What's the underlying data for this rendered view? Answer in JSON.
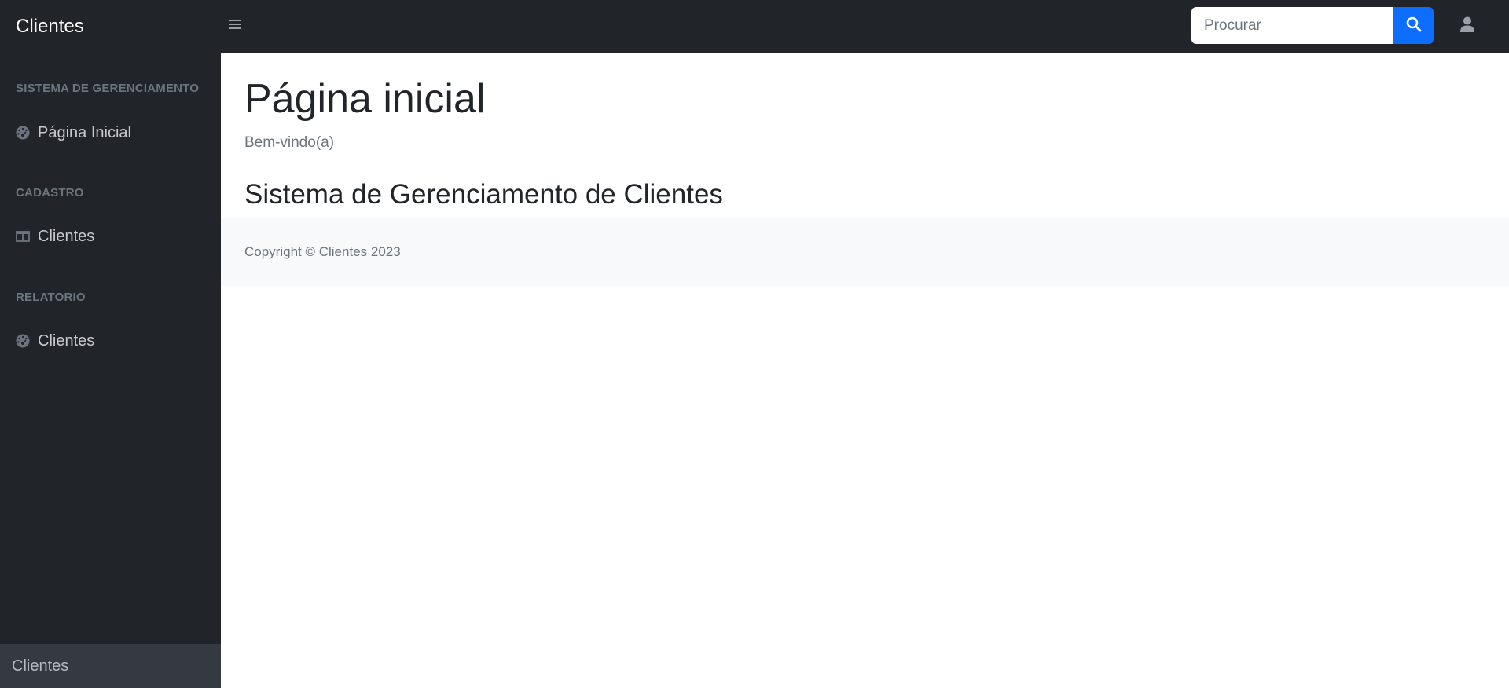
{
  "navbar": {
    "brand": "Clientes",
    "search_placeholder": "Procurar",
    "icons": {
      "toggle": "menu-icon",
      "search": "search-icon",
      "user": "user-icon"
    },
    "colors": {
      "background": "#212529",
      "search_button": "#0d6efd"
    }
  },
  "sidebar": {
    "sections": [
      {
        "heading": "SISTEMA DE GERENCIAMENTO",
        "items": [
          {
            "label": "Página Inicial",
            "icon": "tachometer-icon"
          }
        ]
      },
      {
        "heading": "CADASTRO",
        "items": [
          {
            "label": "Clientes",
            "icon": "columns-icon"
          }
        ]
      },
      {
        "heading": "RELATORIO",
        "items": [
          {
            "label": "Clientes",
            "icon": "tachometer-icon"
          }
        ]
      }
    ],
    "footer": "Clientes",
    "colors": {
      "background": "#212529",
      "footer": "#343a40"
    }
  },
  "main": {
    "title": "Página inicial",
    "subtitle": "Bem-vindo(a)",
    "section_title": "Sistema de Gerenciamento de Clientes",
    "copyright": "Copyright © Clientes 2023"
  }
}
